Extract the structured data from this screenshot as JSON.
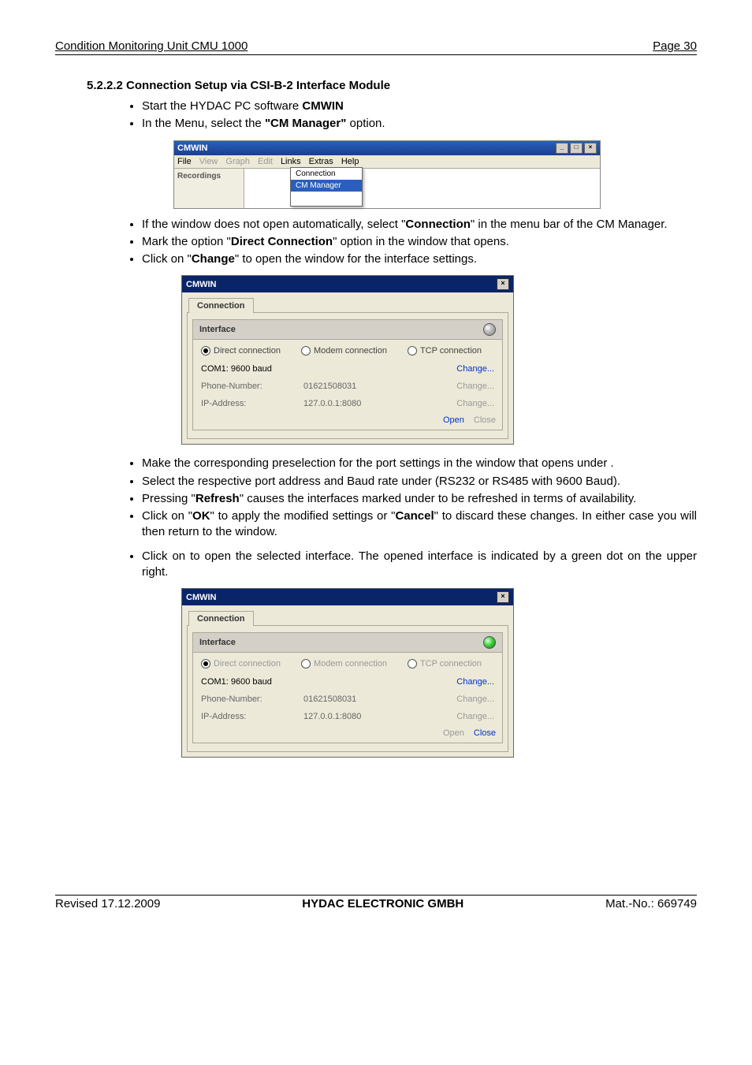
{
  "header": {
    "left": "Condition Monitoring Unit CMU 1000",
    "right": "Page 30"
  },
  "section_title": "5.2.2.2  Connection Setup via CSI-B-2 Interface Module",
  "bullets_a": [
    "Start the HYDAC PC software <b>CMWIN</b>",
    "In the          Menu, select the <b>\"CM Manager\"</b> option."
  ],
  "mini": {
    "title": "CMWIN",
    "menus": [
      "File",
      "View",
      "Graph",
      "Edit",
      "Links",
      "Extras",
      "Help"
    ],
    "menus_dim": [
      false,
      true,
      true,
      true,
      false,
      false,
      false
    ],
    "side_label": "Recordings",
    "dropdown": [
      "Connection",
      "CM Manager"
    ],
    "dropdown_hl_index": 1
  },
  "bullets_b": [
    "If the                  window does not open automatically, select \"<b>Connection</b>\" in the menu bar of the CM Manager.",
    "Mark the option \"<b>Direct Connection</b>\" option in the window that opens.",
    "Click on \"<b>Change</b>\" to open the window for the interface settings."
  ],
  "dialog1": {
    "title": "CMWIN",
    "tab": "Connection",
    "group_title": "Interface",
    "led_green": false,
    "radios": [
      {
        "label": "Direct connection",
        "checked": true,
        "dim": false
      },
      {
        "label": "Modem connection",
        "checked": false,
        "dim": false
      },
      {
        "label": "TCP connection",
        "checked": false,
        "dim": false
      }
    ],
    "rows": [
      {
        "label": "COM1: 9600 baud",
        "value": "",
        "link": "Change...",
        "active": true
      },
      {
        "label": "Phone-Number:",
        "value": "01621508031",
        "link": "Change...",
        "active": false
      },
      {
        "label": "IP-Address:",
        "value": "127.0.0.1:8080",
        "link": "Change...",
        "active": false
      }
    ],
    "footer": [
      {
        "label": "Open",
        "dim": false
      },
      {
        "label": "Close",
        "dim": true
      }
    ]
  },
  "bullets_c": [
    "Make the corresponding preselection for the port settings in the window that opens under                         .",
    "Select the respective port address and Baud rate under (RS232 or RS485 with 9600 Baud).",
    "Pressing \"<b>Refresh</b>\" causes the interfaces marked under                          to be refreshed in terms of availability.",
    "Click on \"<b>OK</b>\" to apply the modified settings or \"<b>Cancel</b>\" to discard these changes. In either case you will then return to the                window."
  ],
  "bullets_d": [
    "Click on        to open the selected interface. The opened interface is indicated by a green dot on the upper right."
  ],
  "dialog2": {
    "title": "CMWIN",
    "tab": "Connection",
    "group_title": "Interface",
    "led_green": true,
    "radios": [
      {
        "label": "Direct connection",
        "checked": true,
        "dim": true
      },
      {
        "label": "Modem connection",
        "checked": false,
        "dim": true
      },
      {
        "label": "TCP connection",
        "checked": false,
        "dim": true
      }
    ],
    "rows": [
      {
        "label": "COM1: 9600 baud",
        "value": "",
        "link": "Change...",
        "active": true
      },
      {
        "label": "Phone-Number:",
        "value": "01621508031",
        "link": "Change...",
        "active": false
      },
      {
        "label": "IP-Address:",
        "value": "127.0.0.1:8080",
        "link": "Change...",
        "active": false
      }
    ],
    "footer": [
      {
        "label": "Open",
        "dim": true
      },
      {
        "label": "Close",
        "dim": false
      }
    ]
  },
  "footer": {
    "left": "Revised 17.12.2009",
    "center": "HYDAC ELECTRONIC GMBH",
    "right": "Mat.-No.: 669749"
  }
}
